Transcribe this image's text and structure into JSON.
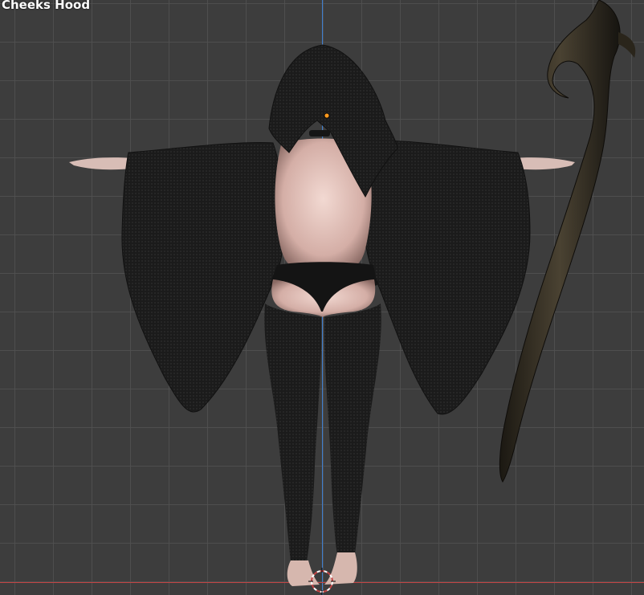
{
  "viewport": {
    "active_object_label": "Cheeks Hood",
    "colors": {
      "background": "#3d3d3d",
      "grid_line": "#505050",
      "axis_z": "#3f7fd0",
      "axis_x": "#c24444",
      "origin_marker": "#ff9a1e",
      "cloth": "#1a1a1a",
      "skin": "#e0c4bc",
      "staff": "#2b261c"
    },
    "icons": {
      "cursor": "3d-cursor-icon",
      "origin": "object-origin-icon"
    }
  }
}
